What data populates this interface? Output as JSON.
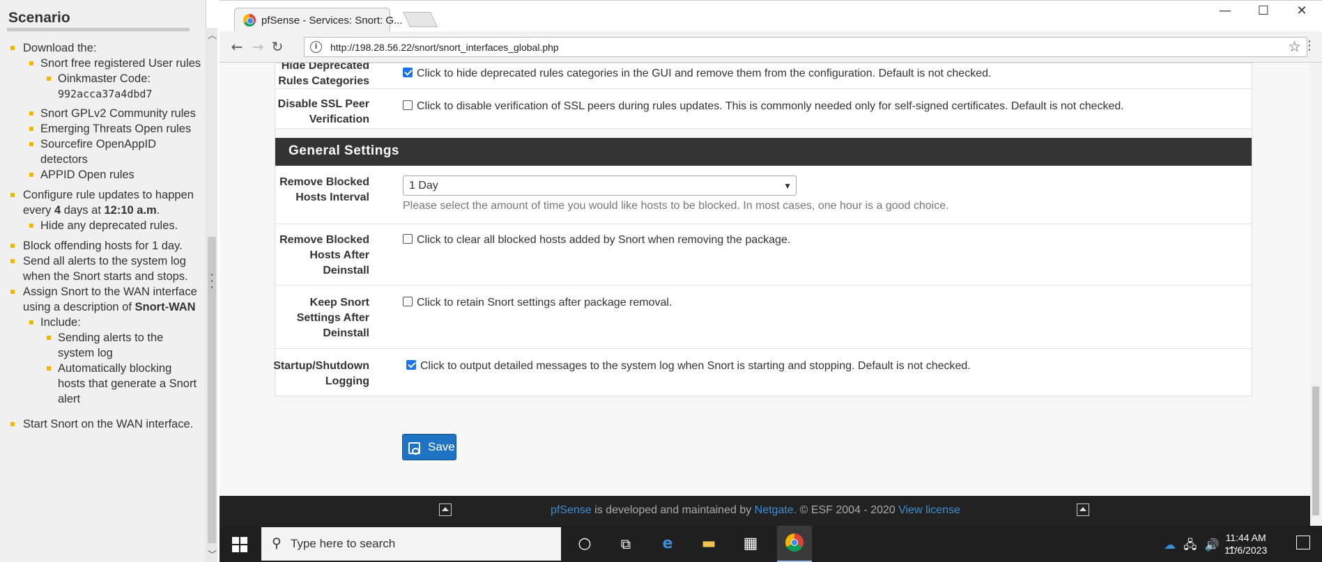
{
  "scenario": {
    "title": "Scenario",
    "items": {
      "download": "Download the:",
      "snort_free": "Snort free registered User rules",
      "oinkmaster_label": "Oinkmaster Code:",
      "oinkmaster_code": "992acca37a4dbd7",
      "gplv2": "Snort GPLv2 Community rules",
      "emerging": "Emerging Threats Open rules",
      "openappid": "Sourcefire OpenAppID detectors",
      "appid": "APPID Open rules",
      "configure_pre": "Configure rule updates to happen every ",
      "configure_days": "4",
      "configure_mid": " days at ",
      "configure_time": "12:10 a.m",
      "configure_end": ".",
      "hide_deprecated": "Hide any deprecated rules.",
      "block": "Block offending hosts for 1 day.",
      "send_alerts": "Send all alerts to the system log when the Snort starts and stops.",
      "assign_pre": "Assign Snort to the WAN interface using a description of ",
      "assign_desc": "Snort-WAN",
      "include": "Include:",
      "include_1": "Sending alerts to the system log",
      "include_2": "Automatically blocking hosts that generate a Snort alert",
      "start": "Start Snort on the WAN interface."
    }
  },
  "browser": {
    "tab_title": "pfSense - Services: Snort: G...",
    "url": "http://198.28.56.22/snort/snort_interfaces_global.php",
    "win_min": "—",
    "win_max": "☐",
    "win_close": "✕"
  },
  "form": {
    "hide_deprecated": {
      "label": "Hide Deprecated Rules Categories",
      "text": "Click to hide deprecated rules categories in the GUI and remove them from the configuration. Default is not checked.",
      "checked": true
    },
    "disable_ssl": {
      "label": "Disable SSL Peer Verification",
      "text": "Click to disable verification of SSL peers during rules updates. This is commonly needed only for self-signed certificates. Default is not checked.",
      "checked": false
    },
    "general_settings_title": "General Settings",
    "remove_blocked_interval": {
      "label": "Remove Blocked Hosts Interval",
      "selected": "1 Day",
      "help": "Please select the amount of time you would like hosts to be blocked. In most cases, one hour is a good choice."
    },
    "remove_blocked_deinstall": {
      "label": "Remove Blocked Hosts After Deinstall",
      "text": "Click to clear all blocked hosts added by Snort when removing the package.",
      "checked": false
    },
    "keep_settings": {
      "label": "Keep Snort Settings After Deinstall",
      "text": "Click to retain Snort settings after package removal.",
      "checked": false
    },
    "startup_logging": {
      "label": "Startup/Shutdown Logging",
      "text": "Click to output detailed messages to the system log when Snort is starting and stopping. Default is not checked.",
      "checked": true
    },
    "save_label": "Save"
  },
  "footer": {
    "pfsense": "pfSense",
    "developed": " is developed and maintained by ",
    "netgate": "Netgate.",
    "copyright": " © ESF 2004 - 2020 ",
    "license": "View license"
  },
  "taskbar": {
    "search_placeholder": "Type here to search",
    "time": "11:44 AM",
    "date": "11/6/2023"
  },
  "colors": {
    "bullet": "#f5b400",
    "section_header": "#333333",
    "save_button": "#1f73c4",
    "link": "#3d8fd6"
  }
}
